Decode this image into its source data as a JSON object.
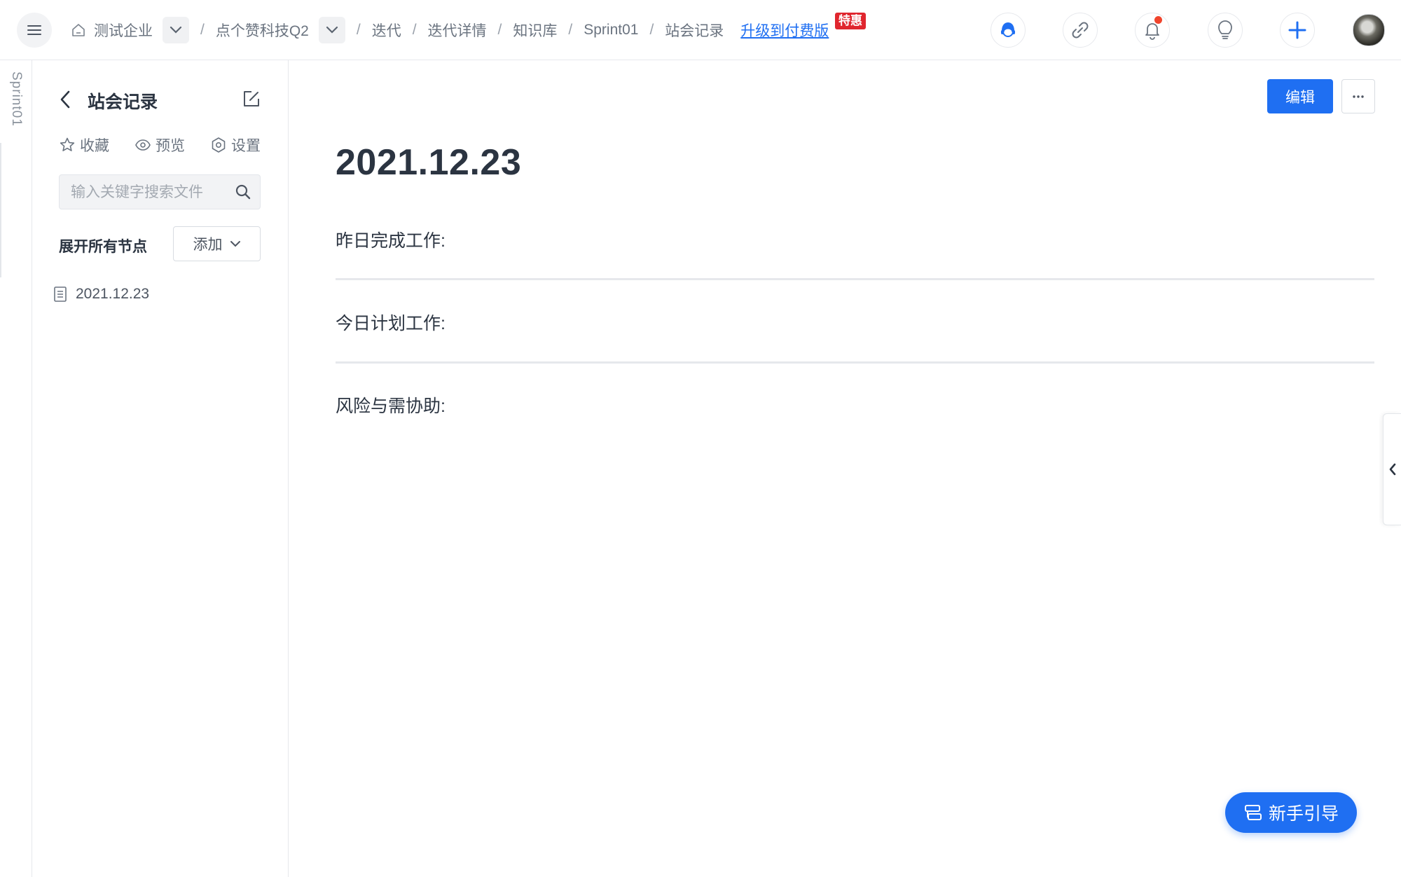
{
  "topbar": {
    "breadcrumb": {
      "company": "测试企业",
      "project": "点个赞科技Q2",
      "items": [
        "迭代",
        "迭代详情",
        "知识库",
        "Sprint01",
        "站会记录"
      ],
      "separator": "/"
    },
    "upgrade_link": "升级到付费版",
    "promo_badge": "特惠",
    "icons": [
      "menu-icon",
      "home-icon",
      "support-agent-icon",
      "link-icon",
      "bell-icon",
      "lightbulb-icon",
      "plus-icon"
    ],
    "has_unread_notifications": true
  },
  "rail": {
    "label": "Sprint01"
  },
  "sidebar": {
    "title": "站会记录",
    "actions": {
      "favorite": "收藏",
      "preview": "预览",
      "settings": "设置"
    },
    "search": {
      "placeholder": "输入关键字搜索文件",
      "value": ""
    },
    "expand_all": "展开所有节点",
    "add_button": "添加",
    "tree": [
      {
        "label": "2021.12.23",
        "icon": "document-icon"
      }
    ]
  },
  "main": {
    "edit_button": "编辑",
    "more_button": "···",
    "title": "2021.12.23",
    "sections": [
      {
        "label": "昨日完成工作:"
      },
      {
        "label": "今日计划工作:"
      },
      {
        "label": "风险与需协助:"
      }
    ],
    "guide_button": "新手引导"
  },
  "colors": {
    "primary": "#1f6ff2",
    "promo_badge": "#e0262e",
    "notification_dot": "#f0442c",
    "text": "#2b3441",
    "muted_text": "#6b7480"
  }
}
